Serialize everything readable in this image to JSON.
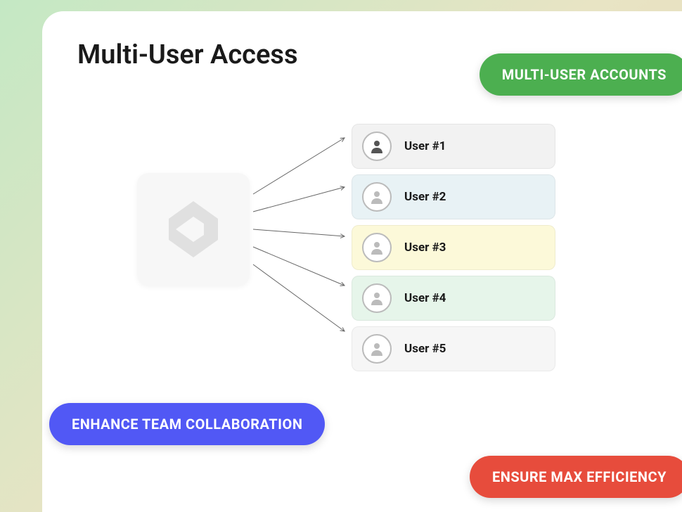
{
  "title": "Multi-User Access",
  "pills": {
    "green": "MULTI-USER ACCOUNTS",
    "blue": "ENHANCE TEAM COLLABORATION",
    "red": "ENSURE MAX EFFICIENCY"
  },
  "users": [
    {
      "label": "User #1",
      "iconFill": "#555"
    },
    {
      "label": "User #2",
      "iconFill": "#bbb"
    },
    {
      "label": "User #3",
      "iconFill": "#bbb"
    },
    {
      "label": "User #4",
      "iconFill": "#bbb"
    },
    {
      "label": "User #5",
      "iconFill": "#bbb"
    }
  ]
}
